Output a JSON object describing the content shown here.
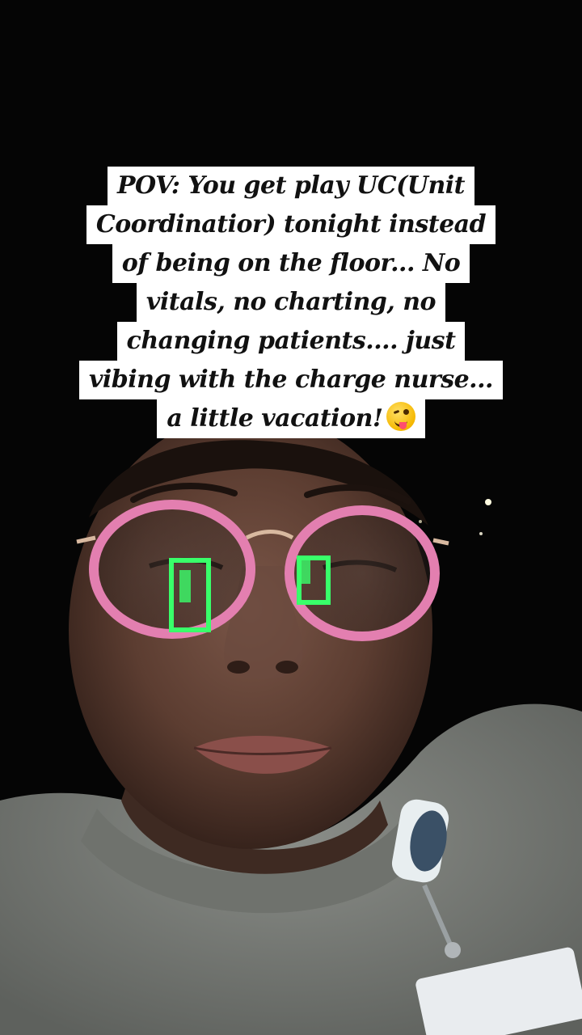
{
  "caption": {
    "lines": [
      "POV: You get play UC(Unit",
      "Coordinatior) tonight instead",
      "of being on the floor... No",
      "vitals, no charting, no",
      "changing patients.... just",
      "vibing with the charge nurse...",
      "a little vacation!"
    ],
    "emoji": "winking-face-with-tongue-icon"
  },
  "colors": {
    "background": "#050505",
    "caption_bg": "#ffffff",
    "caption_text": "#111111",
    "glasses_frame": "#e37fb0",
    "screen_glow": "#39ff6a"
  }
}
